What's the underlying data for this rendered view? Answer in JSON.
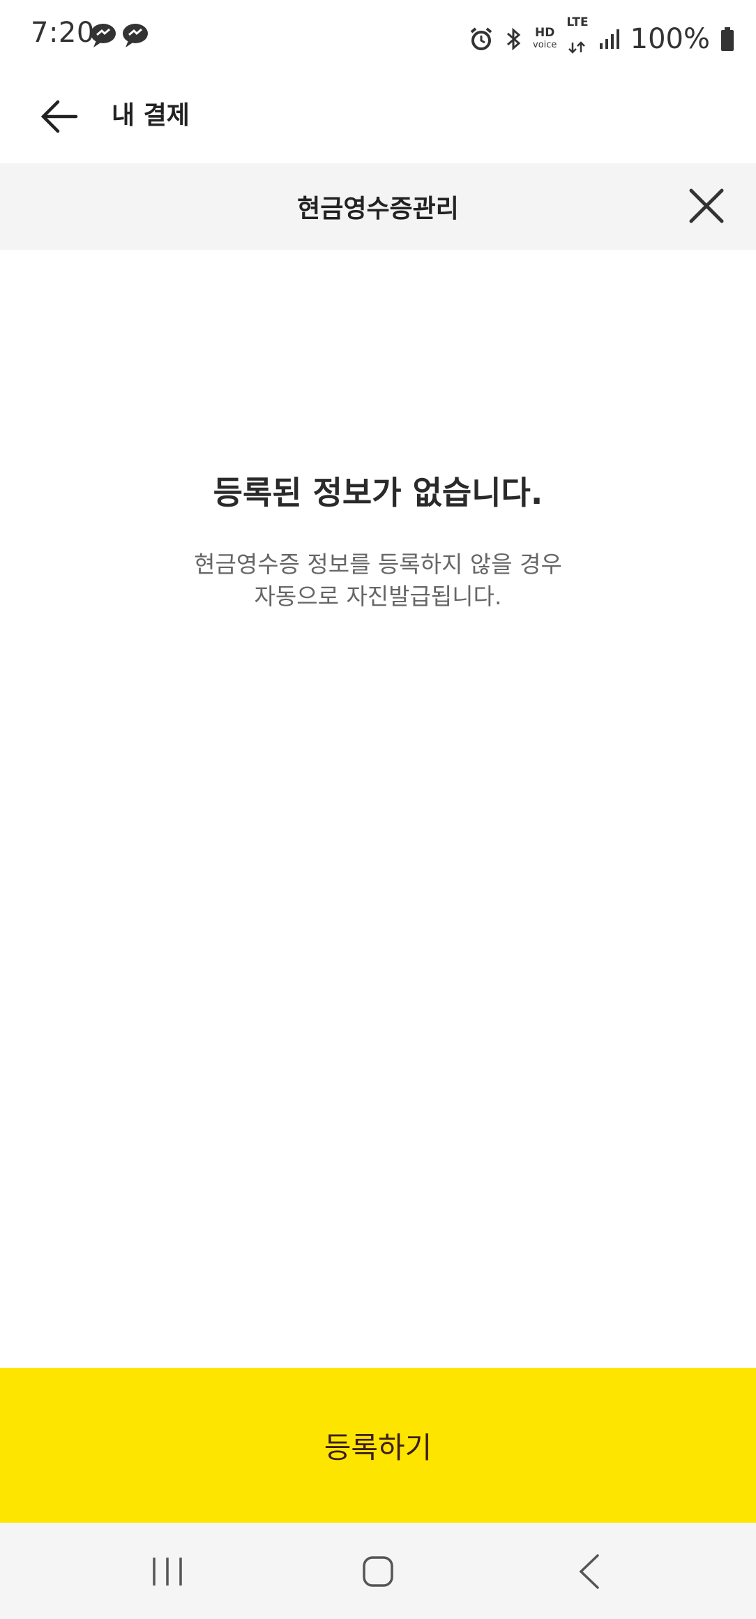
{
  "status_bar": {
    "time": "7:20",
    "notification_icons": [
      "messenger-bubble-icon",
      "messenger-bubble-icon"
    ],
    "hd_label_top": "HD",
    "hd_label_bottom": "voice",
    "lte_label": "LTE",
    "battery_text": "100%"
  },
  "header": {
    "title": "내 결제",
    "back_icon": "arrow-left-icon"
  },
  "sheet": {
    "title": "현금영수증관리",
    "close_icon": "close-icon"
  },
  "empty_state": {
    "title": "등록된 정보가 없습니다.",
    "description_line1": "현금영수증 정보를 등록하지 않을 경우",
    "description_line2": "자동으로 자진발급됩니다."
  },
  "register_button": {
    "label": "등록하기",
    "bg_color": "#fee500",
    "text_color": "#3c1e1e"
  },
  "nav_bar": {
    "icons": [
      "recent-apps-icon",
      "home-icon",
      "back-chevron-icon"
    ]
  }
}
